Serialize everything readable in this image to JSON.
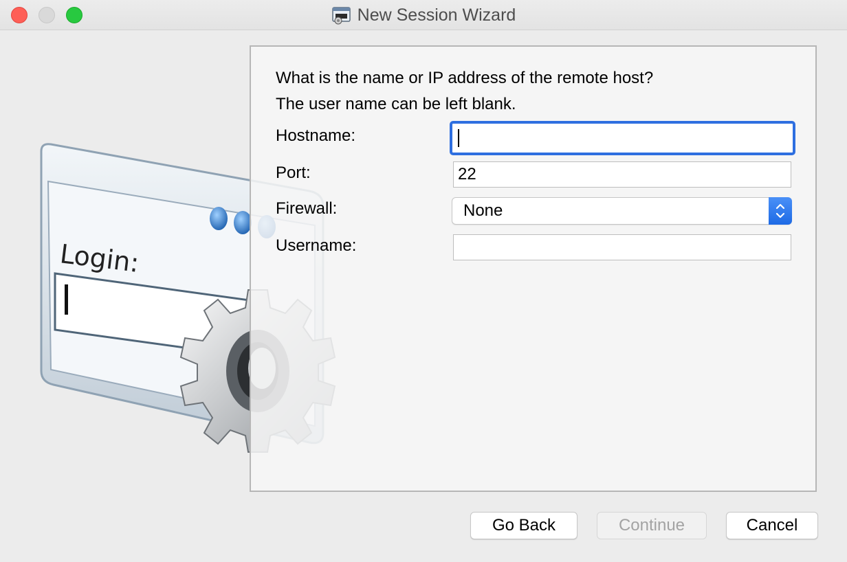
{
  "window": {
    "title": "New Session Wizard"
  },
  "illustration": {
    "login_text": "Login:"
  },
  "form": {
    "prompt_line1": "What is the name or IP address of the remote host?",
    "prompt_line2": "The user name can be left blank.",
    "hostname_label": "Hostname:",
    "hostname_value": "",
    "port_label": "Port:",
    "port_value": "22",
    "firewall_label": "Firewall:",
    "firewall_value": "None",
    "username_label": "Username:",
    "username_value": ""
  },
  "buttons": {
    "back_label": "Go Back",
    "continue_label": "Continue",
    "cancel_label": "Cancel"
  },
  "colors": {
    "focus_ring": "#2e6fe0",
    "close": "#fe5f57",
    "zoom": "#28c940",
    "stepper": "#1d6ae5"
  },
  "icons": {
    "window": "session-app-icon",
    "art": "login-window-gear-illustration",
    "firewall": "updown-chevron-icon"
  }
}
